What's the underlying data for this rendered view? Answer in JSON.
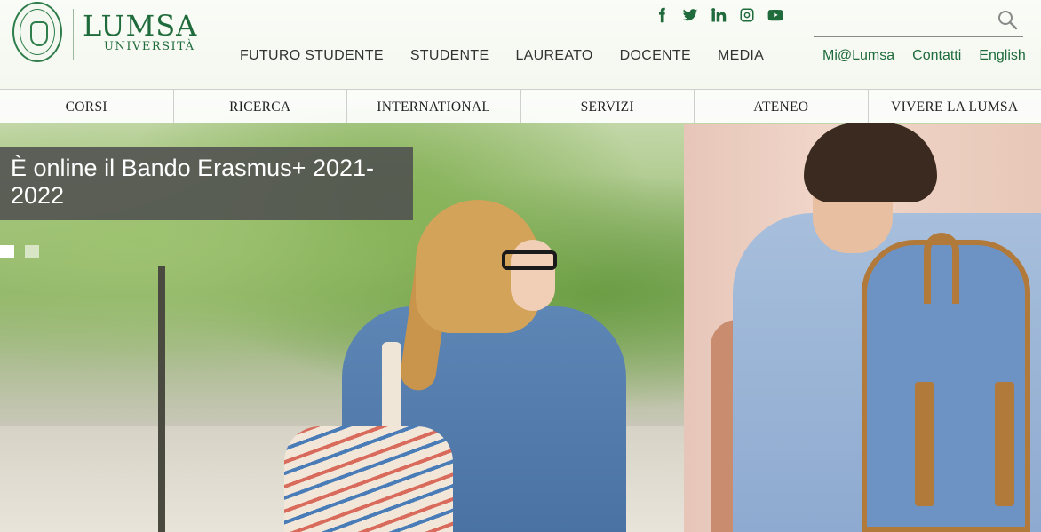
{
  "logo": {
    "name": "LUMSA",
    "sub": "UNIVERSITÀ"
  },
  "social": [
    "facebook-icon",
    "twitter-icon",
    "linkedin-icon",
    "instagram-icon",
    "youtube-icon"
  ],
  "main_nav": [
    "FUTURO STUDENTE",
    "STUDENTE",
    "LAUREATO",
    "DOCENTE",
    "MEDIA"
  ],
  "util_nav": [
    "Mi@Lumsa",
    "Contatti",
    "English"
  ],
  "section_nav": [
    "CORSI",
    "RICERCA",
    "INTERNATIONAL",
    "SERVIZI",
    "ATENEO",
    "VIVERE LA LUMSA"
  ],
  "slide": {
    "caption": "È online il Bando Erasmus+ 2021-2022",
    "active_dot": 1,
    "dot_count": 2
  },
  "colors": {
    "brand_green": "#1f6b3b",
    "caption_bg": "#505050"
  }
}
